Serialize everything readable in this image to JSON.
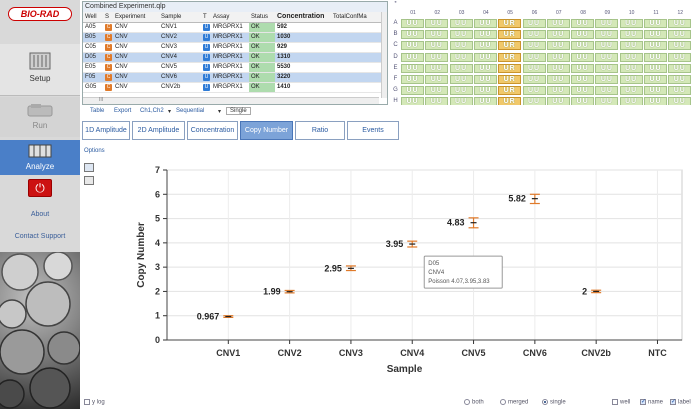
{
  "sidebar": {
    "logo": "BIO-RAD",
    "setup_label": "Setup",
    "run_label": "Run",
    "analyze_label": "Analyze",
    "power_icon": "power-icon",
    "about_label": "About",
    "support_label": "Contact Support"
  },
  "table": {
    "title": "Combined Experiment.qlp",
    "headers": [
      "Well",
      "S",
      "Experiment",
      "Sample",
      "T",
      "Assay",
      "Status",
      "Concentration",
      "TotalConfMa"
    ],
    "rows": [
      {
        "well": "A05",
        "s": "C",
        "experiment": "CNV",
        "sample": "CNV1",
        "t": "U",
        "assay": "MRGPRX1",
        "status": "OK",
        "concentration": "592"
      },
      {
        "well": "B05",
        "s": "C",
        "experiment": "CNV",
        "sample": "CNV2",
        "t": "U",
        "assay": "MRGPRX1",
        "status": "OK",
        "concentration": "1030"
      },
      {
        "well": "C05",
        "s": "C",
        "experiment": "CNV",
        "sample": "CNV3",
        "t": "U",
        "assay": "MRGPRX1",
        "status": "OK",
        "concentration": "929"
      },
      {
        "well": "D05",
        "s": "C",
        "experiment": "CNV",
        "sample": "CNV4",
        "t": "U",
        "assay": "MRGPRX1",
        "status": "OK",
        "concentration": "1310"
      },
      {
        "well": "E05",
        "s": "C",
        "experiment": "CNV",
        "sample": "CNV5",
        "t": "U",
        "assay": "MRGPRX1",
        "status": "OK",
        "concentration": "5530"
      },
      {
        "well": "F05",
        "s": "C",
        "experiment": "CNV",
        "sample": "CNV6",
        "t": "U",
        "assay": "MRGPRX1",
        "status": "OK",
        "concentration": "3220"
      },
      {
        "well": "G05",
        "s": "C",
        "experiment": "CNV",
        "sample": "CNV2b",
        "t": "U",
        "assay": "MRGPRX1",
        "status": "OK",
        "concentration": "1410"
      }
    ],
    "scroll_label": "III"
  },
  "plate": {
    "columns": [
      "01",
      "02",
      "03",
      "04",
      "05",
      "06",
      "07",
      "08",
      "09",
      "10",
      "11",
      "12"
    ],
    "rows": [
      "A",
      "B",
      "C",
      "D",
      "E",
      "F",
      "G",
      "H"
    ],
    "well_label_u": "UU",
    "well_label_c": "UR",
    "col_marker": "*"
  },
  "toolbar": {
    "table": "Table",
    "export": "Export",
    "channel": "Ch1,Ch2",
    "order": "Sequential",
    "mode": "Single"
  },
  "tabs": [
    "1D Amplitude",
    "2D Amplitude",
    "Concentration",
    "Copy Number",
    "Ratio",
    "Events"
  ],
  "options_label": "Options",
  "chart_data": {
    "type": "scatter",
    "categories": [
      "CNV1",
      "CNV2",
      "CNV3",
      "CNV4",
      "CNV5",
      "CNV6",
      "CNV2b",
      "NTC"
    ],
    "values": [
      0.967,
      1.99,
      2.95,
      3.95,
      4.83,
      5.82,
      2,
      null
    ],
    "value_labels": [
      "0.967",
      "1.99",
      "2.95",
      "3.95",
      "4.83",
      "5.82",
      "2",
      ""
    ],
    "error_low": [
      0.93,
      1.94,
      2.86,
      3.83,
      4.62,
      5.62,
      1.95,
      null
    ],
    "error_high": [
      1.0,
      2.04,
      3.05,
      4.07,
      5.03,
      6.0,
      2.05,
      null
    ],
    "xlabel": "Sample",
    "ylabel": "Copy Number",
    "ylim": [
      0,
      7
    ],
    "yticks": [
      0,
      1,
      2,
      3,
      4,
      5,
      6,
      7
    ],
    "grid": true,
    "marker_color": "#e07a2a",
    "tooltip": {
      "well": "D05",
      "sample": "CNV4",
      "poisson": "Poisson 4.07,3.95,3.83"
    }
  },
  "bottombar": {
    "ylog": "y log",
    "both": "both",
    "merged": "merged",
    "single": "single",
    "well": "well",
    "name": "name",
    "label": "label"
  },
  "colors": {
    "accent": "#4a7fc8",
    "well_ok": "#d4e8b8",
    "status_ok": "#aedcae",
    "power": "#cc1111"
  }
}
